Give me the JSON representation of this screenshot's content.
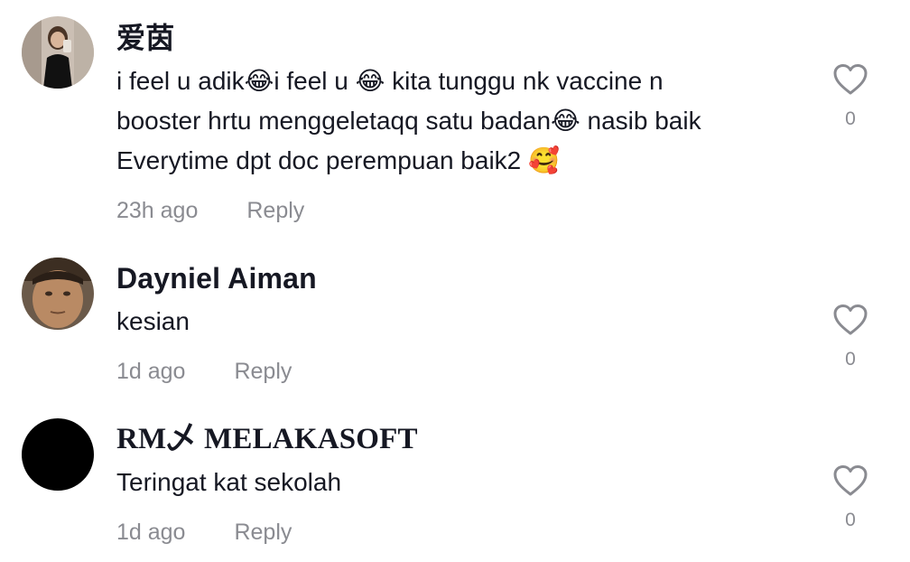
{
  "comments": [
    {
      "username": "爱茵",
      "text_lines": [
        "i feel u adik😂i feel u 😂 kita tunggu nk vaccine n",
        "booster hrtu menggeletaqq satu badan😂 nasib baik",
        "Everytime dpt doc perempuan baik2 🥰"
      ],
      "time": "23h ago",
      "reply_label": "Reply",
      "likes": "0",
      "avatar": "photo-woman-black-dress"
    },
    {
      "username": "Dayniel Aiman",
      "text_lines": [
        "kesian"
      ],
      "time": "1d ago",
      "reply_label": "Reply",
      "likes": "0",
      "avatar": "photo-man-face"
    },
    {
      "username": "RM乄 MELAKASOFT",
      "text_lines": [
        "Teringat kat sekolah"
      ],
      "time": "1d ago",
      "reply_label": "Reply",
      "likes": "0",
      "avatar": "black-circle"
    }
  ],
  "icons": {
    "like": "heart-outline-icon"
  },
  "colors": {
    "text": "#161823",
    "secondary": "#8a8b91",
    "background": "#ffffff"
  }
}
